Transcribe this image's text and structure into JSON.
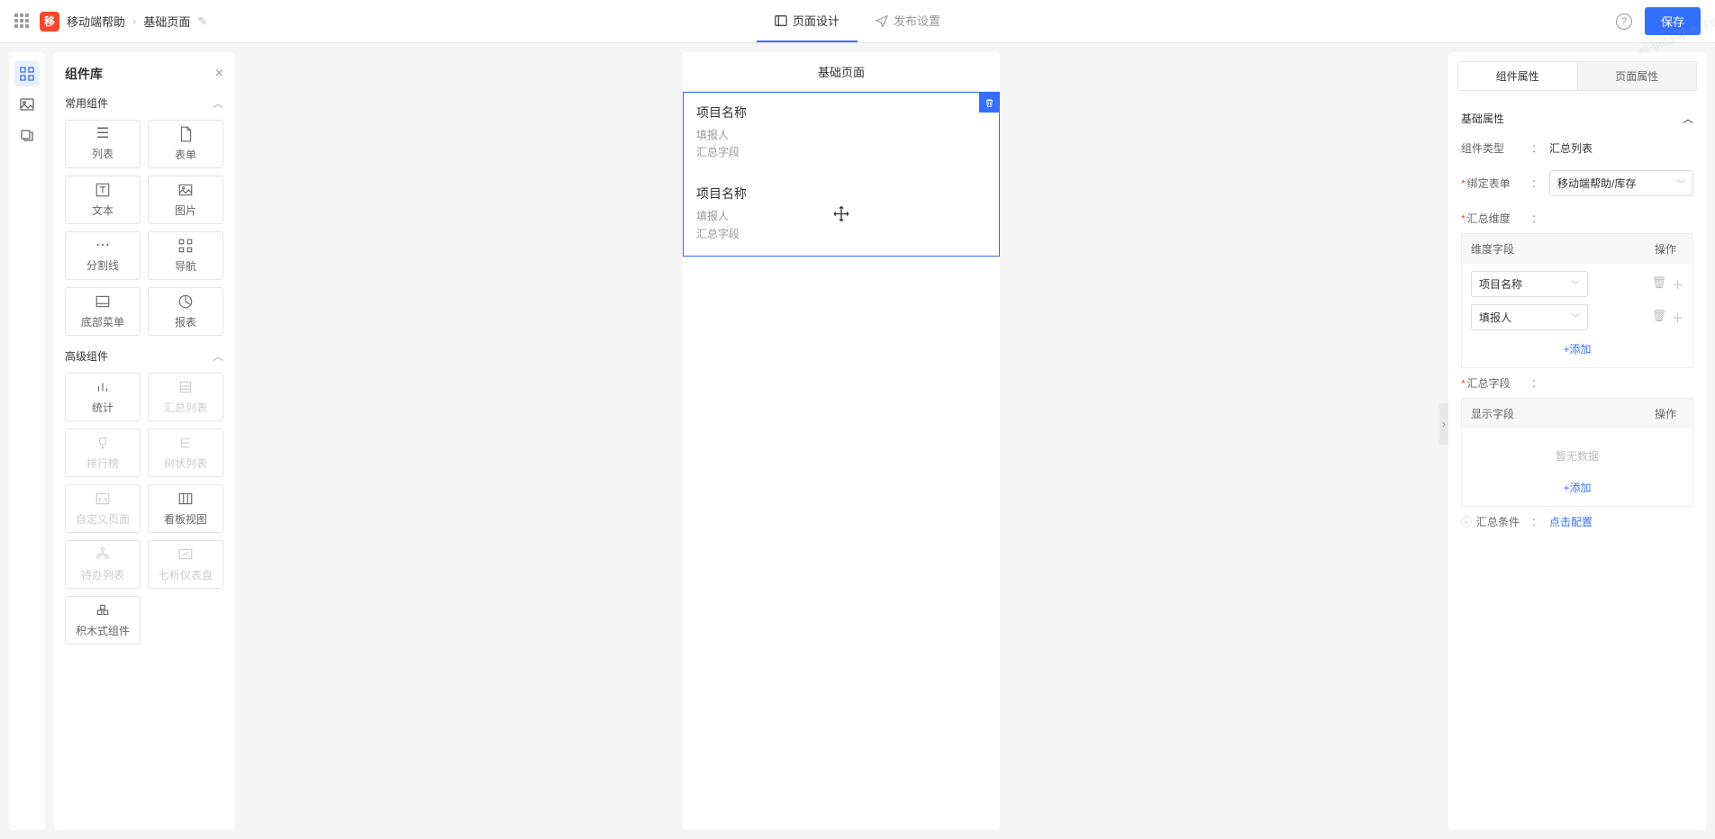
{
  "header": {
    "app_name": "移动端帮助",
    "page_name": "基础页面",
    "app_badge_char": "移",
    "tabs": {
      "design": "页面设计",
      "publish": "发布设置"
    },
    "save": "保存"
  },
  "watermark": "as-beta-基本环境",
  "library": {
    "title": "组件库",
    "sections": {
      "common": {
        "title": "常用组件",
        "items": [
          "列表",
          "表单",
          "文本",
          "图片",
          "分割线",
          "导航",
          "底部菜单",
          "报表"
        ]
      },
      "advanced": {
        "title": "高级组件",
        "items": [
          "统计",
          "汇总列表",
          "排行榜",
          "树状列表",
          "自定义页面",
          "看板视图",
          "待办列表",
          "七析仪表盘",
          "积木式组件"
        ]
      }
    }
  },
  "canvas": {
    "title": "基础页面",
    "card": {
      "title": "项目名称",
      "sub1": "填报人",
      "sub2": "汇总字段"
    }
  },
  "props": {
    "tabs": {
      "component": "组件属性",
      "page": "页面属性"
    },
    "group_basic": "基础属性",
    "labels": {
      "comp_type": "组件类型",
      "bind_table": "绑定表单",
      "dimension": "汇总维度",
      "dim_field": "维度字段",
      "action": "操作",
      "summary_field": "汇总字段",
      "display_field": "显示字段",
      "condition": "汇总条件"
    },
    "values": {
      "comp_type": "汇总列表",
      "bind_table": "移动端帮助/库存",
      "dim_options": [
        "项目名称",
        "填报人"
      ],
      "add": "+添加",
      "empty": "暂无数据",
      "condition_link": "点击配置"
    }
  }
}
